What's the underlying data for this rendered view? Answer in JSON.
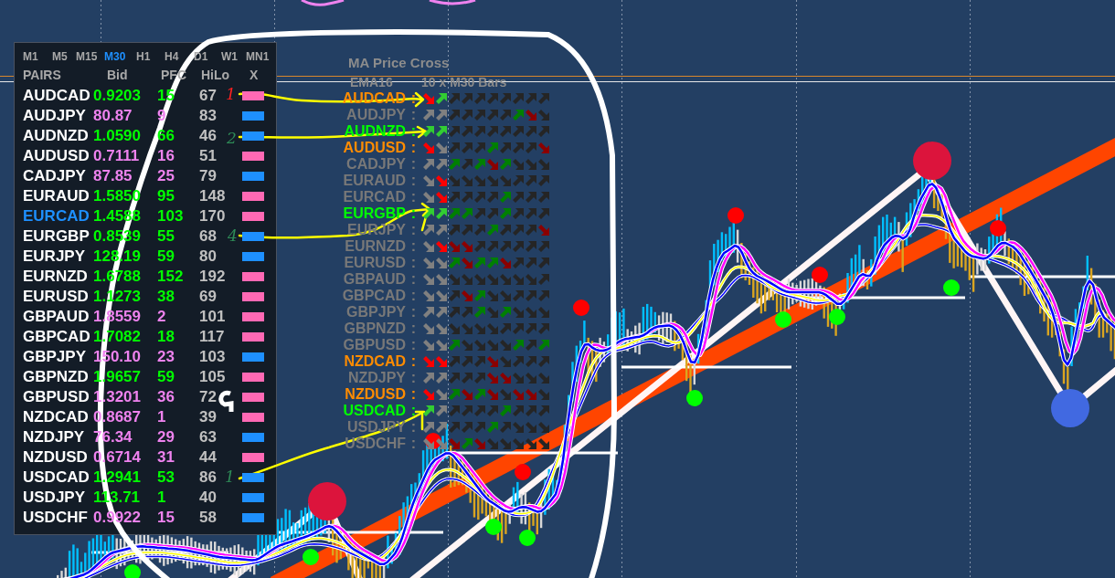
{
  "timeframes": [
    {
      "label": "M1",
      "selected": false
    },
    {
      "label": "M5",
      "selected": false
    },
    {
      "label": "M15",
      "selected": false
    },
    {
      "label": "M30",
      "selected": true
    },
    {
      "label": "H1",
      "selected": false
    },
    {
      "label": "H4",
      "selected": false
    },
    {
      "label": "D1",
      "selected": false
    },
    {
      "label": "W1",
      "selected": false
    },
    {
      "label": "MN1",
      "selected": false
    }
  ],
  "pairs_table": {
    "columns": [
      "PAIRS",
      "Bid",
      "PFC",
      "HiLo",
      "X"
    ],
    "rows": [
      {
        "pair": "AUDCAD",
        "selected": false,
        "bid": "0.9203",
        "pfc": "15",
        "hilo": "67",
        "color": "#00ff00",
        "marker": {
          "color": "#ff69b4"
        }
      },
      {
        "pair": "AUDJPY",
        "selected": false,
        "bid": "80.87",
        "pfc": "9",
        "hilo": "83",
        "color": "#ee82ee",
        "marker": {
          "color": "#1e90ff"
        }
      },
      {
        "pair": "AUDNZD",
        "selected": false,
        "bid": "1.0590",
        "pfc": "66",
        "hilo": "46",
        "color": "#00ff00",
        "marker": {
          "color": "#1e90ff"
        }
      },
      {
        "pair": "AUDUSD",
        "selected": false,
        "bid": "0.7111",
        "pfc": "16",
        "hilo": "51",
        "color": "#ee82ee",
        "marker": {
          "color": "#ff69b4"
        }
      },
      {
        "pair": "CADJPY",
        "selected": false,
        "bid": "87.85",
        "pfc": "25",
        "hilo": "79",
        "color": "#ee82ee",
        "marker": {
          "color": "#1e90ff"
        }
      },
      {
        "pair": "EURAUD",
        "selected": false,
        "bid": "1.5850",
        "pfc": "95",
        "hilo": "148",
        "color": "#00ff00",
        "marker": {
          "color": "#ff69b4"
        }
      },
      {
        "pair": "EURCAD",
        "selected": true,
        "bid": "1.4588",
        "pfc": "103",
        "hilo": "170",
        "color": "#00ff00",
        "marker": {
          "color": "#ff69b4"
        }
      },
      {
        "pair": "EURGBP",
        "selected": false,
        "bid": "0.8539",
        "pfc": "55",
        "hilo": "68",
        "color": "#00ff00",
        "marker": {
          "color": "#1e90ff"
        }
      },
      {
        "pair": "EURJPY",
        "selected": false,
        "bid": "128.19",
        "pfc": "59",
        "hilo": "80",
        "color": "#00ff00",
        "marker": {
          "color": "#1e90ff"
        }
      },
      {
        "pair": "EURNZD",
        "selected": false,
        "bid": "1.6788",
        "pfc": "152",
        "hilo": "192",
        "color": "#00ff00",
        "marker": {
          "color": "#ff69b4"
        }
      },
      {
        "pair": "EURUSD",
        "selected": false,
        "bid": "1.1273",
        "pfc": "38",
        "hilo": "69",
        "color": "#00ff00",
        "marker": {
          "color": "#ff69b4"
        }
      },
      {
        "pair": "GBPAUD",
        "selected": false,
        "bid": "1.8559",
        "pfc": "2",
        "hilo": "101",
        "color": "#ee82ee",
        "marker": {
          "color": "#ff69b4"
        }
      },
      {
        "pair": "GBPCAD",
        "selected": false,
        "bid": "1.7082",
        "pfc": "18",
        "hilo": "117",
        "color": "#00ff00",
        "marker": {
          "color": "#ff69b4"
        }
      },
      {
        "pair": "GBPJPY",
        "selected": false,
        "bid": "150.10",
        "pfc": "23",
        "hilo": "103",
        "color": "#ee82ee",
        "marker": {
          "color": "#1e90ff"
        }
      },
      {
        "pair": "GBPNZD",
        "selected": false,
        "bid": "1.9657",
        "pfc": "59",
        "hilo": "105",
        "color": "#00ff00",
        "marker": {
          "color": "#ff69b4"
        }
      },
      {
        "pair": "GBPUSD",
        "selected": false,
        "bid": "1.3201",
        "pfc": "36",
        "hilo": "72",
        "color": "#ee82ee",
        "marker": {
          "color": "#ff69b4"
        }
      },
      {
        "pair": "NZDCAD",
        "selected": false,
        "bid": "0.8687",
        "pfc": "1",
        "hilo": "39",
        "color": "#ee82ee",
        "marker": {
          "color": "#ff69b4"
        }
      },
      {
        "pair": "NZDJPY",
        "selected": false,
        "bid": "76.34",
        "pfc": "29",
        "hilo": "63",
        "color": "#ee82ee",
        "marker": {
          "color": "#1e90ff"
        }
      },
      {
        "pair": "NZDUSD",
        "selected": false,
        "bid": "0.6714",
        "pfc": "31",
        "hilo": "44",
        "color": "#ee82ee",
        "marker": {
          "color": "#ff69b4"
        }
      },
      {
        "pair": "USDCAD",
        "selected": false,
        "bid": "1.2941",
        "pfc": "53",
        "hilo": "86",
        "color": "#00ff00",
        "marker": {
          "color": "#1e90ff"
        }
      },
      {
        "pair": "USDJPY",
        "selected": false,
        "bid": "113.71",
        "pfc": "1",
        "hilo": "40",
        "color": "#00ff00",
        "marker": {
          "color": "#1e90ff"
        }
      },
      {
        "pair": "USDCHF",
        "selected": false,
        "bid": "0.9922",
        "pfc": "15",
        "hilo": "58",
        "color": "#ee82ee",
        "marker": {
          "color": "#1e90ff"
        }
      }
    ]
  },
  "ma_cross": {
    "title": "MA Price Cross",
    "ma_label": "EMA16",
    "bars_label": "10 x M30 Bars",
    "rows": [
      {
        "pair": "AUDCAD",
        "separator": ":",
        "color": "#ff8c00",
        "arrows": [
          {
            "kind": "down",
            "color": "#ff0000"
          },
          {
            "kind": "up",
            "color": "#32cd32"
          },
          {
            "kind": "up",
            "color": "#252525"
          },
          {
            "kind": "up",
            "color": "#252525"
          },
          {
            "kind": "up",
            "color": "#252525"
          },
          {
            "kind": "up",
            "color": "#252525"
          },
          {
            "kind": "up",
            "color": "#252525"
          },
          {
            "kind": "up",
            "color": "#252525"
          },
          {
            "kind": "up",
            "color": "#252525"
          },
          {
            "kind": "up",
            "color": "#252525"
          }
        ]
      },
      {
        "pair": "AUDJPY",
        "separator": ":",
        "color": "#787878",
        "arrows": [
          {
            "kind": "up",
            "color": "#808080"
          },
          {
            "kind": "up",
            "color": "#808080"
          },
          {
            "kind": "up",
            "color": "#252525"
          },
          {
            "kind": "up",
            "color": "#252525"
          },
          {
            "kind": "up",
            "color": "#252525"
          },
          {
            "kind": "up",
            "color": "#252525"
          },
          {
            "kind": "up",
            "color": "#252525"
          },
          {
            "kind": "up",
            "color": "#008000"
          },
          {
            "kind": "down",
            "color": "#8b0000"
          },
          {
            "kind": "down",
            "color": "#252525"
          }
        ]
      },
      {
        "pair": "AUDNZD",
        "separator": ":",
        "color": "#00ff00",
        "arrows": [
          {
            "kind": "up",
            "color": "#32cd32"
          },
          {
            "kind": "up",
            "color": "#32cd32"
          },
          {
            "kind": "up",
            "color": "#252525"
          },
          {
            "kind": "up",
            "color": "#252525"
          },
          {
            "kind": "up",
            "color": "#252525"
          },
          {
            "kind": "up",
            "color": "#252525"
          },
          {
            "kind": "up",
            "color": "#252525"
          },
          {
            "kind": "up",
            "color": "#252525"
          },
          {
            "kind": "up",
            "color": "#252525"
          },
          {
            "kind": "up",
            "color": "#252525"
          }
        ]
      },
      {
        "pair": "AUDUSD",
        "separator": ":",
        "color": "#ff8c00",
        "arrows": [
          {
            "kind": "down",
            "color": "#ff0000"
          },
          {
            "kind": "down",
            "color": "#808080"
          },
          {
            "kind": "up",
            "color": "#252525"
          },
          {
            "kind": "up",
            "color": "#252525"
          },
          {
            "kind": "up",
            "color": "#252525"
          },
          {
            "kind": "up",
            "color": "#008000"
          },
          {
            "kind": "up",
            "color": "#252525"
          },
          {
            "kind": "up",
            "color": "#252525"
          },
          {
            "kind": "up",
            "color": "#252525"
          },
          {
            "kind": "down",
            "color": "#8b0000"
          }
        ]
      },
      {
        "pair": "CADJPY",
        "separator": ":",
        "color": "#787878",
        "arrows": [
          {
            "kind": "up",
            "color": "#808080"
          },
          {
            "kind": "up",
            "color": "#808080"
          },
          {
            "kind": "up",
            "color": "#008000"
          },
          {
            "kind": "up",
            "color": "#252525"
          },
          {
            "kind": "up",
            "color": "#008000"
          },
          {
            "kind": "down",
            "color": "#8b0000"
          },
          {
            "kind": "up",
            "color": "#008000"
          },
          {
            "kind": "down",
            "color": "#252525"
          },
          {
            "kind": "down",
            "color": "#252525"
          },
          {
            "kind": "down",
            "color": "#252525"
          }
        ]
      },
      {
        "pair": "EURAUD",
        "separator": ":",
        "color": "#787878",
        "arrows": [
          {
            "kind": "down",
            "color": "#808080"
          },
          {
            "kind": "down",
            "color": "#ff0000"
          },
          {
            "kind": "down",
            "color": "#252525"
          },
          {
            "kind": "down",
            "color": "#252525"
          },
          {
            "kind": "down",
            "color": "#252525"
          },
          {
            "kind": "down",
            "color": "#252525"
          },
          {
            "kind": "down",
            "color": "#252525"
          },
          {
            "kind": "up",
            "color": "#252525"
          },
          {
            "kind": "up",
            "color": "#252525"
          },
          {
            "kind": "up",
            "color": "#252525"
          }
        ]
      },
      {
        "pair": "EURCAD",
        "separator": ":",
        "color": "#787878",
        "arrows": [
          {
            "kind": "down",
            "color": "#808080"
          },
          {
            "kind": "down",
            "color": "#ff0000"
          },
          {
            "kind": "up",
            "color": "#252525"
          },
          {
            "kind": "up",
            "color": "#252525"
          },
          {
            "kind": "up",
            "color": "#252525"
          },
          {
            "kind": "up",
            "color": "#252525"
          },
          {
            "kind": "up",
            "color": "#008000"
          },
          {
            "kind": "up",
            "color": "#252525"
          },
          {
            "kind": "up",
            "color": "#252525"
          },
          {
            "kind": "up",
            "color": "#252525"
          }
        ]
      },
      {
        "pair": "EURGBP",
        "separator": ":",
        "color": "#00ff00",
        "arrows": [
          {
            "kind": "up",
            "color": "#32cd32"
          },
          {
            "kind": "up",
            "color": "#32cd32"
          },
          {
            "kind": "up",
            "color": "#008000"
          },
          {
            "kind": "up",
            "color": "#008000"
          },
          {
            "kind": "up",
            "color": "#252525"
          },
          {
            "kind": "up",
            "color": "#252525"
          },
          {
            "kind": "up",
            "color": "#008000"
          },
          {
            "kind": "up",
            "color": "#252525"
          },
          {
            "kind": "up",
            "color": "#252525"
          },
          {
            "kind": "up",
            "color": "#252525"
          }
        ]
      },
      {
        "pair": "EURJPY",
        "separator": ":",
        "color": "#787878",
        "arrows": [
          {
            "kind": "up",
            "color": "#808080"
          },
          {
            "kind": "up",
            "color": "#808080"
          },
          {
            "kind": "up",
            "color": "#252525"
          },
          {
            "kind": "up",
            "color": "#252525"
          },
          {
            "kind": "up",
            "color": "#252525"
          },
          {
            "kind": "up",
            "color": "#008000"
          },
          {
            "kind": "up",
            "color": "#252525"
          },
          {
            "kind": "up",
            "color": "#252525"
          },
          {
            "kind": "up",
            "color": "#252525"
          },
          {
            "kind": "down",
            "color": "#8b0000"
          }
        ]
      },
      {
        "pair": "EURNZD",
        "separator": ":",
        "color": "#787878",
        "arrows": [
          {
            "kind": "down",
            "color": "#808080"
          },
          {
            "kind": "down",
            "color": "#ff0000"
          },
          {
            "kind": "down",
            "color": "#8b0000"
          },
          {
            "kind": "down",
            "color": "#8b0000"
          },
          {
            "kind": "up",
            "color": "#252525"
          },
          {
            "kind": "up",
            "color": "#252525"
          },
          {
            "kind": "up",
            "color": "#252525"
          },
          {
            "kind": "up",
            "color": "#252525"
          },
          {
            "kind": "up",
            "color": "#252525"
          },
          {
            "kind": "up",
            "color": "#252525"
          }
        ]
      },
      {
        "pair": "EURUSD",
        "separator": ":",
        "color": "#787878",
        "arrows": [
          {
            "kind": "down",
            "color": "#808080"
          },
          {
            "kind": "down",
            "color": "#808080"
          },
          {
            "kind": "up",
            "color": "#008000"
          },
          {
            "kind": "down",
            "color": "#8b0000"
          },
          {
            "kind": "up",
            "color": "#008000"
          },
          {
            "kind": "up",
            "color": "#008000"
          },
          {
            "kind": "down",
            "color": "#8b0000"
          },
          {
            "kind": "up",
            "color": "#252525"
          },
          {
            "kind": "up",
            "color": "#252525"
          },
          {
            "kind": "up",
            "color": "#252525"
          }
        ]
      },
      {
        "pair": "GBPAUD",
        "separator": ":",
        "color": "#787878",
        "arrows": [
          {
            "kind": "down",
            "color": "#808080"
          },
          {
            "kind": "down",
            "color": "#808080"
          },
          {
            "kind": "down",
            "color": "#252525"
          },
          {
            "kind": "down",
            "color": "#252525"
          },
          {
            "kind": "down",
            "color": "#252525"
          },
          {
            "kind": "down",
            "color": "#252525"
          },
          {
            "kind": "down",
            "color": "#252525"
          },
          {
            "kind": "down",
            "color": "#252525"
          },
          {
            "kind": "down",
            "color": "#252525"
          },
          {
            "kind": "up",
            "color": "#252525"
          }
        ]
      },
      {
        "pair": "GBPCAD",
        "separator": ":",
        "color": "#787878",
        "arrows": [
          {
            "kind": "down",
            "color": "#808080"
          },
          {
            "kind": "down",
            "color": "#808080"
          },
          {
            "kind": "up",
            "color": "#252525"
          },
          {
            "kind": "down",
            "color": "#8b0000"
          },
          {
            "kind": "up",
            "color": "#008000"
          },
          {
            "kind": "down",
            "color": "#252525"
          },
          {
            "kind": "down",
            "color": "#252525"
          },
          {
            "kind": "up",
            "color": "#252525"
          },
          {
            "kind": "up",
            "color": "#252525"
          },
          {
            "kind": "up",
            "color": "#252525"
          }
        ]
      },
      {
        "pair": "GBPJPY",
        "separator": ":",
        "color": "#787878",
        "arrows": [
          {
            "kind": "up",
            "color": "#808080"
          },
          {
            "kind": "up",
            "color": "#808080"
          },
          {
            "kind": "up",
            "color": "#252525"
          },
          {
            "kind": "up",
            "color": "#252525"
          },
          {
            "kind": "up",
            "color": "#008000"
          },
          {
            "kind": "down",
            "color": "#252525"
          },
          {
            "kind": "up",
            "color": "#008000"
          },
          {
            "kind": "down",
            "color": "#252525"
          },
          {
            "kind": "down",
            "color": "#252525"
          },
          {
            "kind": "down",
            "color": "#252525"
          }
        ]
      },
      {
        "pair": "GBPNZD",
        "separator": ":",
        "color": "#787878",
        "arrows": [
          {
            "kind": "down",
            "color": "#808080"
          },
          {
            "kind": "down",
            "color": "#808080"
          },
          {
            "kind": "down",
            "color": "#252525"
          },
          {
            "kind": "down",
            "color": "#252525"
          },
          {
            "kind": "down",
            "color": "#252525"
          },
          {
            "kind": "down",
            "color": "#252525"
          },
          {
            "kind": "up",
            "color": "#252525"
          },
          {
            "kind": "up",
            "color": "#252525"
          },
          {
            "kind": "up",
            "color": "#252525"
          },
          {
            "kind": "up",
            "color": "#252525"
          }
        ]
      },
      {
        "pair": "GBPUSD",
        "separator": ":",
        "color": "#787878",
        "arrows": [
          {
            "kind": "down",
            "color": "#808080"
          },
          {
            "kind": "down",
            "color": "#808080"
          },
          {
            "kind": "up",
            "color": "#008000"
          },
          {
            "kind": "down",
            "color": "#252525"
          },
          {
            "kind": "down",
            "color": "#252525"
          },
          {
            "kind": "down",
            "color": "#252525"
          },
          {
            "kind": "down",
            "color": "#252525"
          },
          {
            "kind": "up",
            "color": "#008000"
          },
          {
            "kind": "up",
            "color": "#252525"
          },
          {
            "kind": "up",
            "color": "#008000"
          }
        ]
      },
      {
        "pair": "NZDCAD",
        "separator": ":",
        "color": "#ff8c00",
        "arrows": [
          {
            "kind": "down",
            "color": "#ff0000"
          },
          {
            "kind": "down",
            "color": "#ff0000"
          },
          {
            "kind": "up",
            "color": "#252525"
          },
          {
            "kind": "up",
            "color": "#252525"
          },
          {
            "kind": "up",
            "color": "#252525"
          },
          {
            "kind": "down",
            "color": "#8b0000"
          },
          {
            "kind": "down",
            "color": "#252525"
          },
          {
            "kind": "up",
            "color": "#252525"
          },
          {
            "kind": "up",
            "color": "#252525"
          },
          {
            "kind": "up",
            "color": "#252525"
          }
        ]
      },
      {
        "pair": "NZDJPY",
        "separator": ":",
        "color": "#787878",
        "arrows": [
          {
            "kind": "up",
            "color": "#808080"
          },
          {
            "kind": "up",
            "color": "#808080"
          },
          {
            "kind": "up",
            "color": "#252525"
          },
          {
            "kind": "up",
            "color": "#252525"
          },
          {
            "kind": "up",
            "color": "#252525"
          },
          {
            "kind": "down",
            "color": "#8b0000"
          },
          {
            "kind": "down",
            "color": "#8b0000"
          },
          {
            "kind": "down",
            "color": "#252525"
          },
          {
            "kind": "down",
            "color": "#252525"
          },
          {
            "kind": "down",
            "color": "#252525"
          }
        ]
      },
      {
        "pair": "NZDUSD",
        "separator": ":",
        "color": "#ff8c00",
        "arrows": [
          {
            "kind": "down",
            "color": "#ff0000"
          },
          {
            "kind": "down",
            "color": "#808080"
          },
          {
            "kind": "up",
            "color": "#008000"
          },
          {
            "kind": "down",
            "color": "#8b0000"
          },
          {
            "kind": "up",
            "color": "#008000"
          },
          {
            "kind": "down",
            "color": "#8b0000"
          },
          {
            "kind": "down",
            "color": "#252525"
          },
          {
            "kind": "down",
            "color": "#8b0000"
          },
          {
            "kind": "down",
            "color": "#8b0000"
          },
          {
            "kind": "down",
            "color": "#252525"
          }
        ]
      },
      {
        "pair": "USDCAD",
        "separator": ":",
        "color": "#00ff00",
        "arrows": [
          {
            "kind": "up",
            "color": "#32cd32"
          },
          {
            "kind": "up",
            "color": "#808080"
          },
          {
            "kind": "up",
            "color": "#252525"
          },
          {
            "kind": "up",
            "color": "#252525"
          },
          {
            "kind": "up",
            "color": "#252525"
          },
          {
            "kind": "up",
            "color": "#252525"
          },
          {
            "kind": "up",
            "color": "#008000"
          },
          {
            "kind": "up",
            "color": "#252525"
          },
          {
            "kind": "up",
            "color": "#252525"
          },
          {
            "kind": "up",
            "color": "#252525"
          }
        ]
      },
      {
        "pair": "USDJPY",
        "separator": ":",
        "color": "#787878",
        "arrows": [
          {
            "kind": "up",
            "color": "#808080"
          },
          {
            "kind": "up",
            "color": "#808080"
          },
          {
            "kind": "up",
            "color": "#252525"
          },
          {
            "kind": "up",
            "color": "#252525"
          },
          {
            "kind": "up",
            "color": "#252525"
          },
          {
            "kind": "up",
            "color": "#008000"
          },
          {
            "kind": "up",
            "color": "#252525"
          },
          {
            "kind": "down",
            "color": "#252525"
          },
          {
            "kind": "down",
            "color": "#252525"
          },
          {
            "kind": "down",
            "color": "#252525"
          }
        ]
      },
      {
        "pair": "USDCHF",
        "separator": ":",
        "color": "#787878",
        "arrows": [
          {
            "kind": "down",
            "color": "#808080"
          },
          {
            "kind": "down",
            "color": "#808080"
          },
          {
            "kind": "down",
            "color": "#8b0000"
          },
          {
            "kind": "up",
            "color": "#008000"
          },
          {
            "kind": "down",
            "color": "#8b0000"
          },
          {
            "kind": "down",
            "color": "#252525"
          },
          {
            "kind": "down",
            "color": "#252525"
          },
          {
            "kind": "down",
            "color": "#252525"
          },
          {
            "kind": "down",
            "color": "#252525"
          },
          {
            "kind": "down",
            "color": "#252525"
          }
        ]
      }
    ]
  },
  "annotations": [
    {
      "text": "1",
      "color": "#ff2020"
    },
    {
      "text": "2",
      "color": "#2e8b57"
    },
    {
      "text": "4",
      "color": "#2e8b57"
    },
    {
      "text": "1",
      "color": "#2e8b57"
    }
  ]
}
